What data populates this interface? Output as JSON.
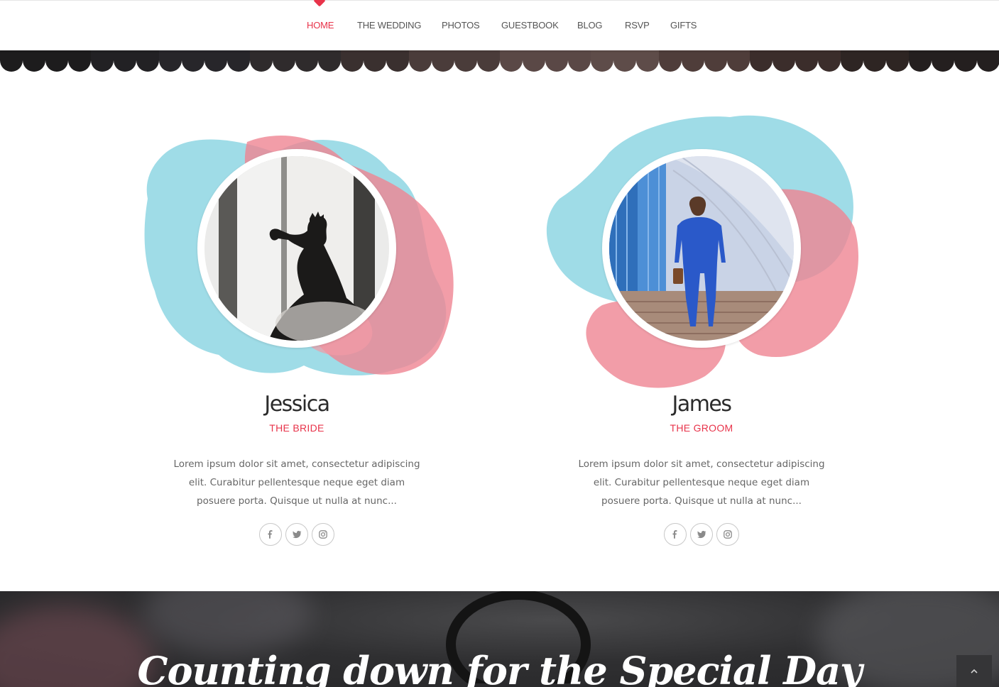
{
  "nav": {
    "items": [
      {
        "label": "HOME",
        "active": true
      },
      {
        "label": "THE WEDDING",
        "active": false
      },
      {
        "label": "PHOTOS",
        "active": false
      },
      {
        "label": "GUESTBOOK",
        "active": false
      },
      {
        "label": "BLOG",
        "active": false
      },
      {
        "label": "RSVP",
        "active": false
      },
      {
        "label": "GIFTS",
        "active": false
      }
    ]
  },
  "couple": {
    "bride": {
      "name": "Jessica",
      "role": "THE BRIDE",
      "bio": "Lorem ipsum dolor sit amet, consectetur adipiscing elit. Curabitur pellentesque neque eget diam posuere porta. Quisque ut nulla at nunc...",
      "socials": [
        "facebook-icon",
        "twitter-icon",
        "instagram-icon"
      ]
    },
    "groom": {
      "name": "James",
      "role": "THE GROOM",
      "bio": "Lorem ipsum dolor sit amet, consectetur adipiscing elit. Curabitur pellentesque neque eget diam posuere porta. Quisque ut nulla at nunc...",
      "socials": [
        "facebook-icon",
        "twitter-icon",
        "instagram-icon"
      ]
    }
  },
  "countdown": {
    "title": "Counting down for the Special Day"
  },
  "colors": {
    "accent": "#e8334a",
    "watercolor_blue": "#7fd0df",
    "watercolor_pink": "#ef8592",
    "dark_band": "#2f2f31"
  },
  "back_to_top": {
    "icon": "chevron-up-icon"
  }
}
